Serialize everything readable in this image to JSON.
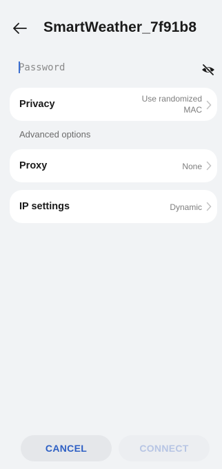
{
  "header": {
    "title": "SmartWeather_7f91b8"
  },
  "password": {
    "placeholder": "Password",
    "value": ""
  },
  "privacy": {
    "label": "Privacy",
    "value_line1": "Use randomized",
    "value_line2": "MAC"
  },
  "advanced": {
    "label": "Advanced options"
  },
  "proxy": {
    "label": "Proxy",
    "value": "None"
  },
  "ip": {
    "label": "IP settings",
    "value": "Dynamic"
  },
  "buttons": {
    "cancel": "CANCEL",
    "connect": "CONNECT"
  },
  "colors": {
    "accent": "#2d5fc4",
    "background": "#f1f3f5",
    "card": "#ffffff"
  },
  "icons": {
    "back": "back-arrow-icon",
    "visibility": "eye-off-icon",
    "chevron": "chevron-right-icon"
  }
}
